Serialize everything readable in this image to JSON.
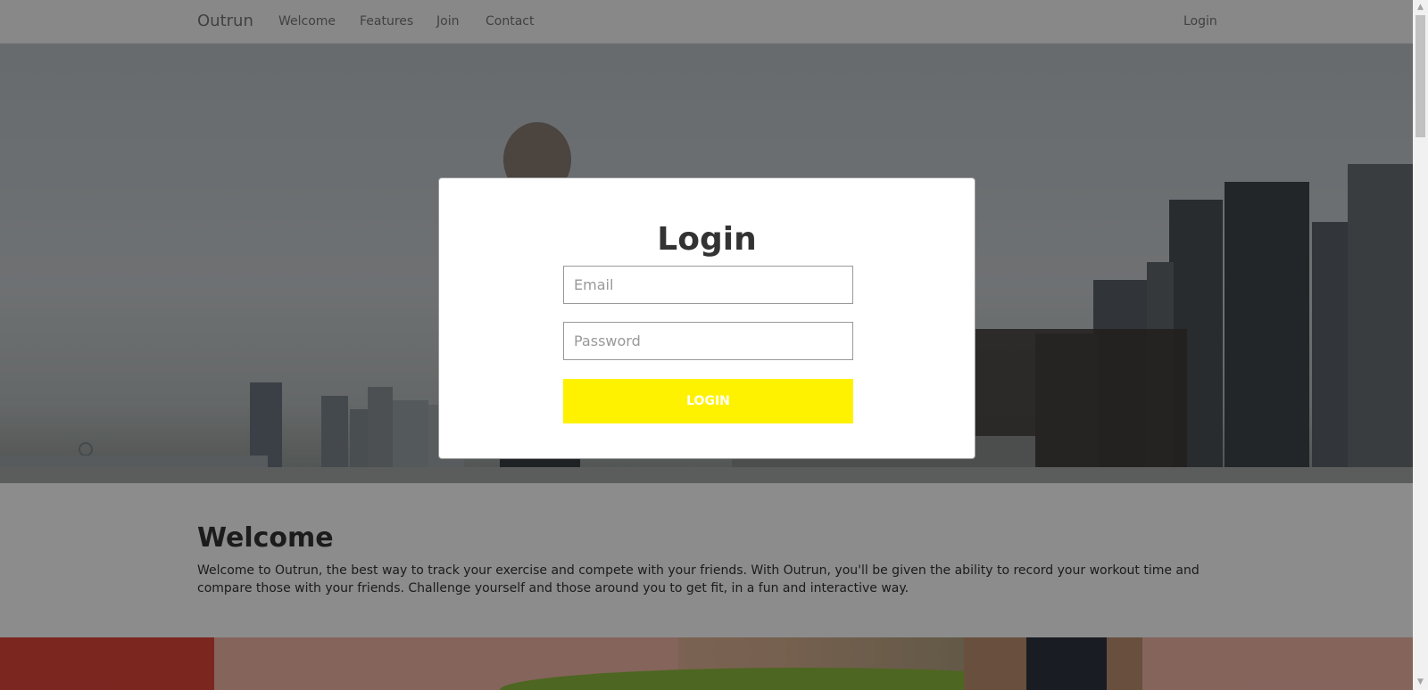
{
  "nav": {
    "brand": "Outrun",
    "links": [
      "Welcome",
      "Features",
      "Join",
      "Contact"
    ],
    "login": "Login"
  },
  "welcome": {
    "title": "Welcome",
    "text": "Welcome to Outrun, the best way to track your exercise and compete with your friends. With Outrun, you'll be given the ability to record your workout time and compare those with your friends. Challenge yourself and those around you to get fit, in a fun and interactive way."
  },
  "modal": {
    "title": "Login",
    "email_placeholder": "Email",
    "password_placeholder": "Password",
    "button_label": "LOGIN"
  },
  "colors": {
    "accent": "#fff200",
    "overlay": "rgba(0,0,0,0.45)"
  },
  "icons": {
    "scroll_up": "triangle-up",
    "scroll_down": "triangle-down"
  }
}
